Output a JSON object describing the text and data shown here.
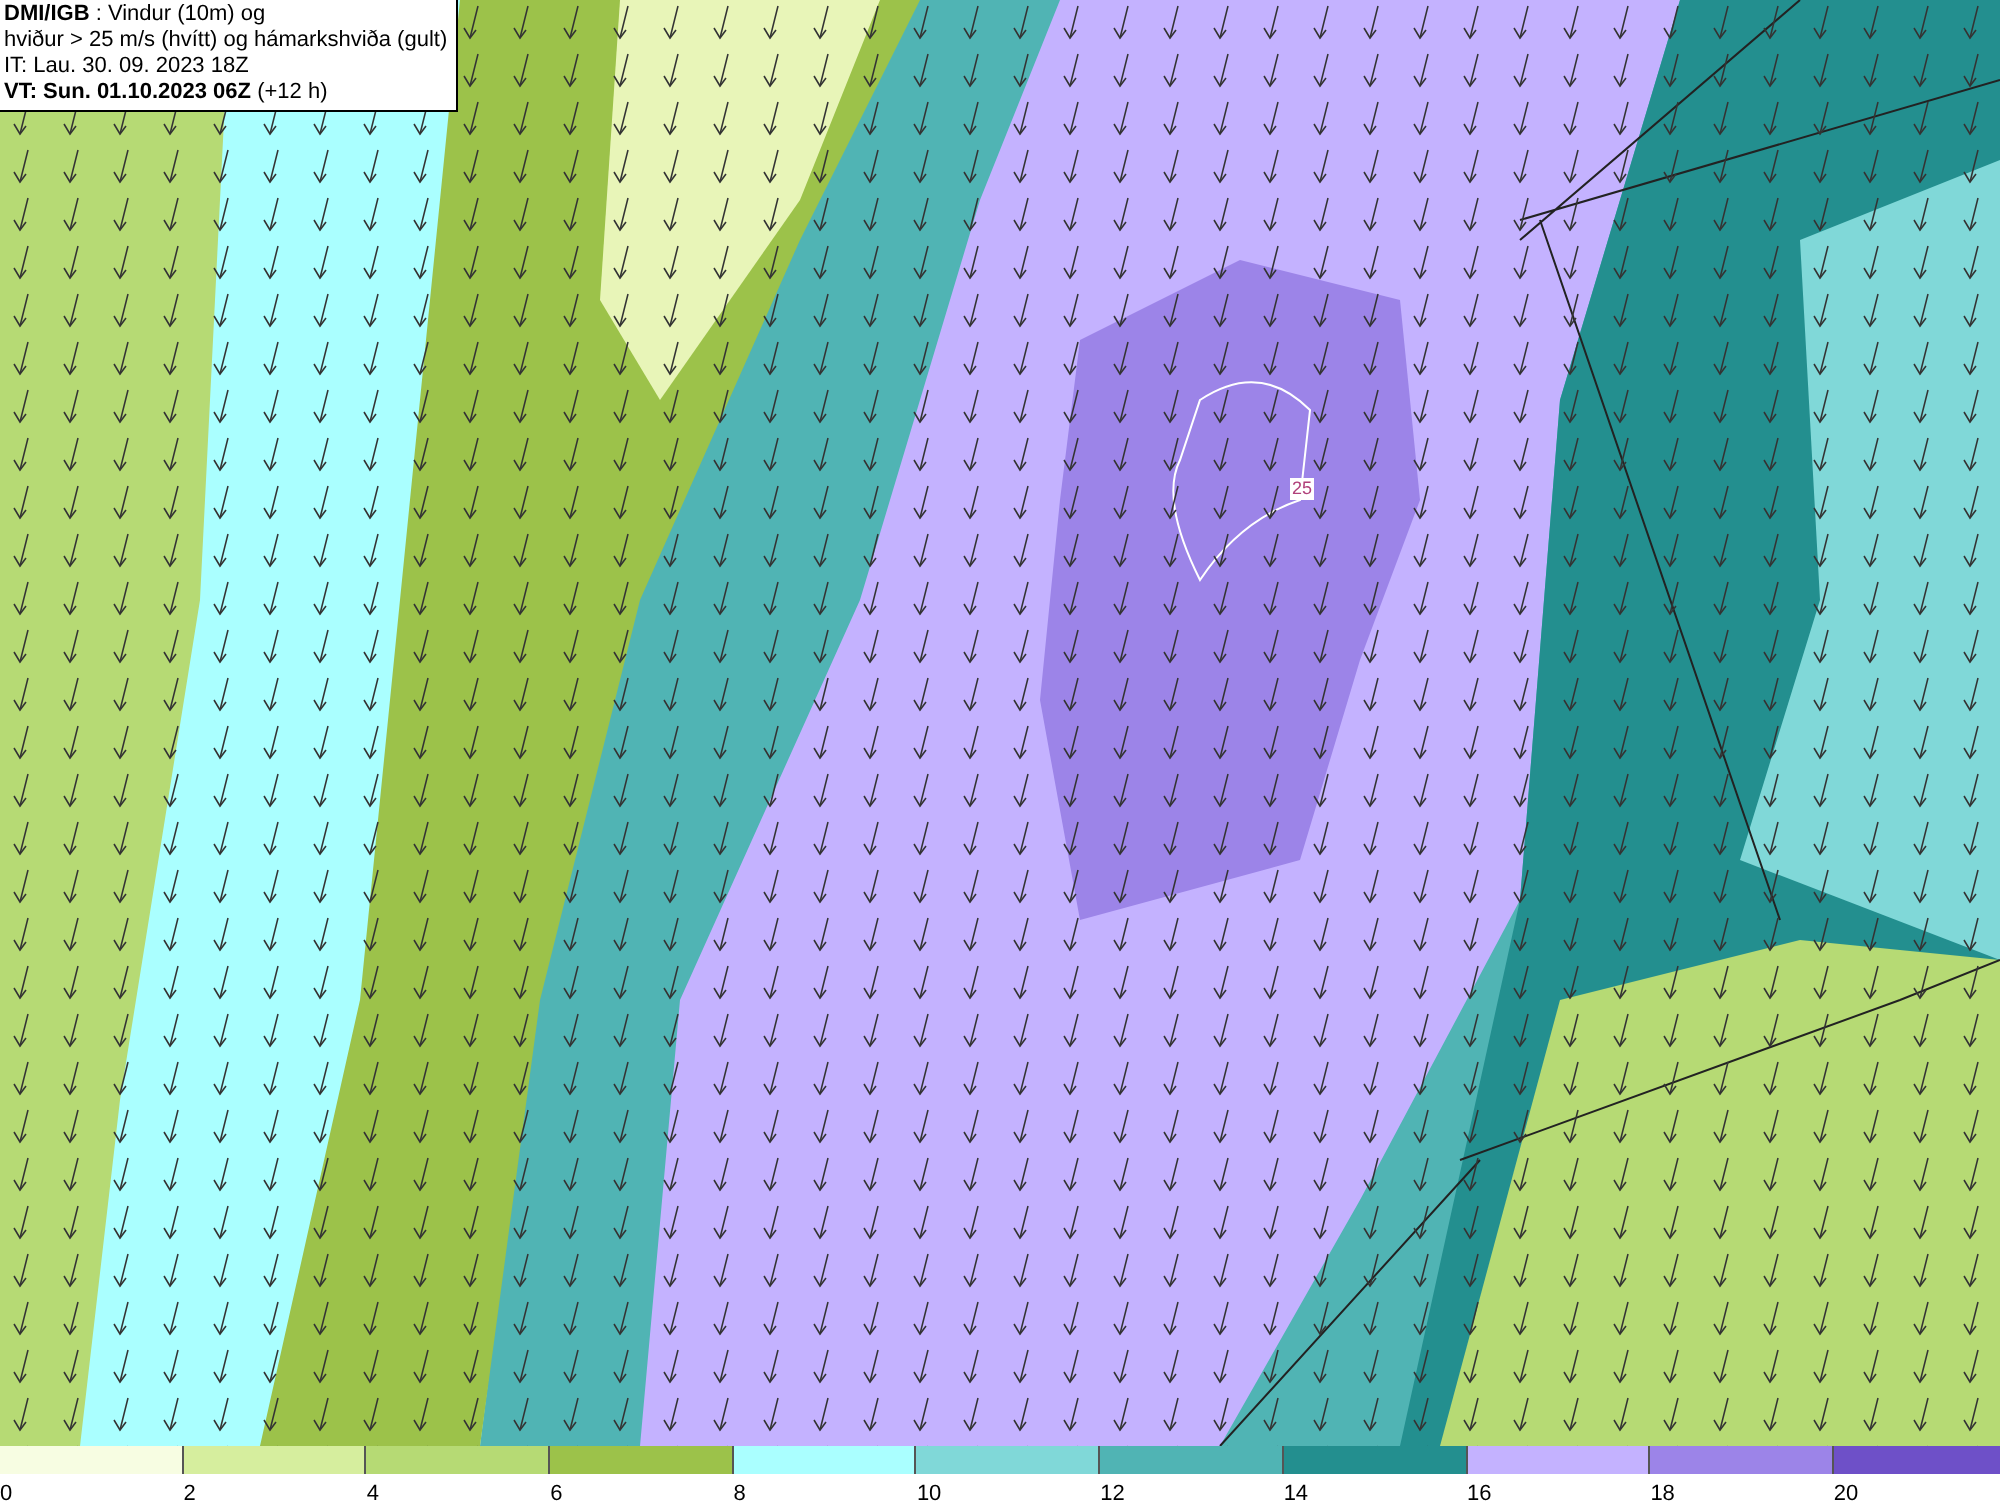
{
  "title_box": {
    "lines": [
      "**DMI/IGB** : Vindur (10m) og",
      "hviður > 25 m/s (hvítt) og hámarkshviða (gult)",
      "IT: Lau. 30. 09. 2023 18Z",
      "**VT: Sun. 01.10.2023 06Z** (+12 h)"
    ]
  },
  "map": {
    "contour_label": "25"
  },
  "legend": {
    "items": [
      {
        "label": "0",
        "color": "#f7fde2"
      },
      {
        "label": "2",
        "color": "#d6ee9e"
      },
      {
        "label": "4",
        "color": "#b6da74"
      },
      {
        "label": "6",
        "color": "#9cc24a"
      },
      {
        "label": "8",
        "color": "#aaffff"
      },
      {
        "label": "10",
        "color": "#80d8d8"
      },
      {
        "label": "12",
        "color": "#50b4b4"
      },
      {
        "label": "14",
        "color": "#238f8f"
      },
      {
        "label": "16",
        "color": "#c4b2ff"
      },
      {
        "label": "18",
        "color": "#9c84e8"
      },
      {
        "label": "20",
        "color": "#6e50c8"
      }
    ]
  }
}
